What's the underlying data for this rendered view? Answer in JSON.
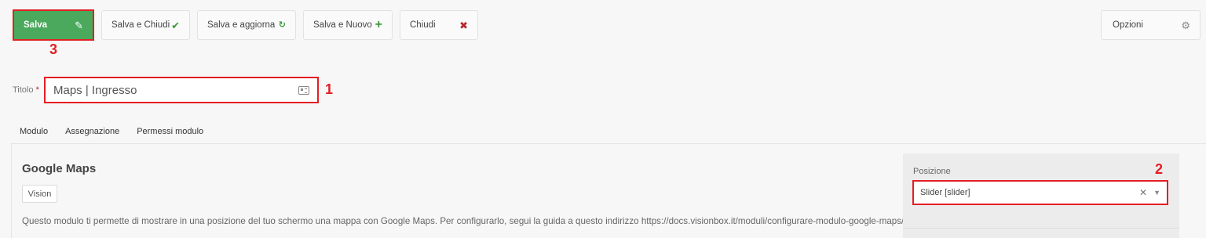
{
  "toolbar": {
    "save_label": "Salva",
    "save_close_label": "Salva e Chiudi",
    "save_update_label": "Salva e aggiorna",
    "save_new_label": "Salva e Nuovo",
    "close_label": "Chiudi",
    "options_label": "Opzioni"
  },
  "annotations": {
    "one": "1",
    "two": "2",
    "three": "3"
  },
  "title_field": {
    "label": "Titolo",
    "required_mark": "*",
    "value": "Maps | Ingresso"
  },
  "tabs": [
    {
      "label": "Modulo"
    },
    {
      "label": "Assegnazione"
    },
    {
      "label": "Permessi modulo"
    }
  ],
  "module": {
    "title": "Google Maps",
    "badge": "Vision",
    "description": "Questo modulo ti permette di mostrare in una posizione del tuo schermo una mappa con Google Maps. Per configurarlo, segui la guida a questo indirizzo https://docs.visionbox.it/moduli/configurare-modulo-google-maps/"
  },
  "position": {
    "label": "Posizione",
    "selected": "Slider [slider]"
  },
  "colors": {
    "save_green": "#4aa95c",
    "highlight_red": "#e31e24"
  }
}
